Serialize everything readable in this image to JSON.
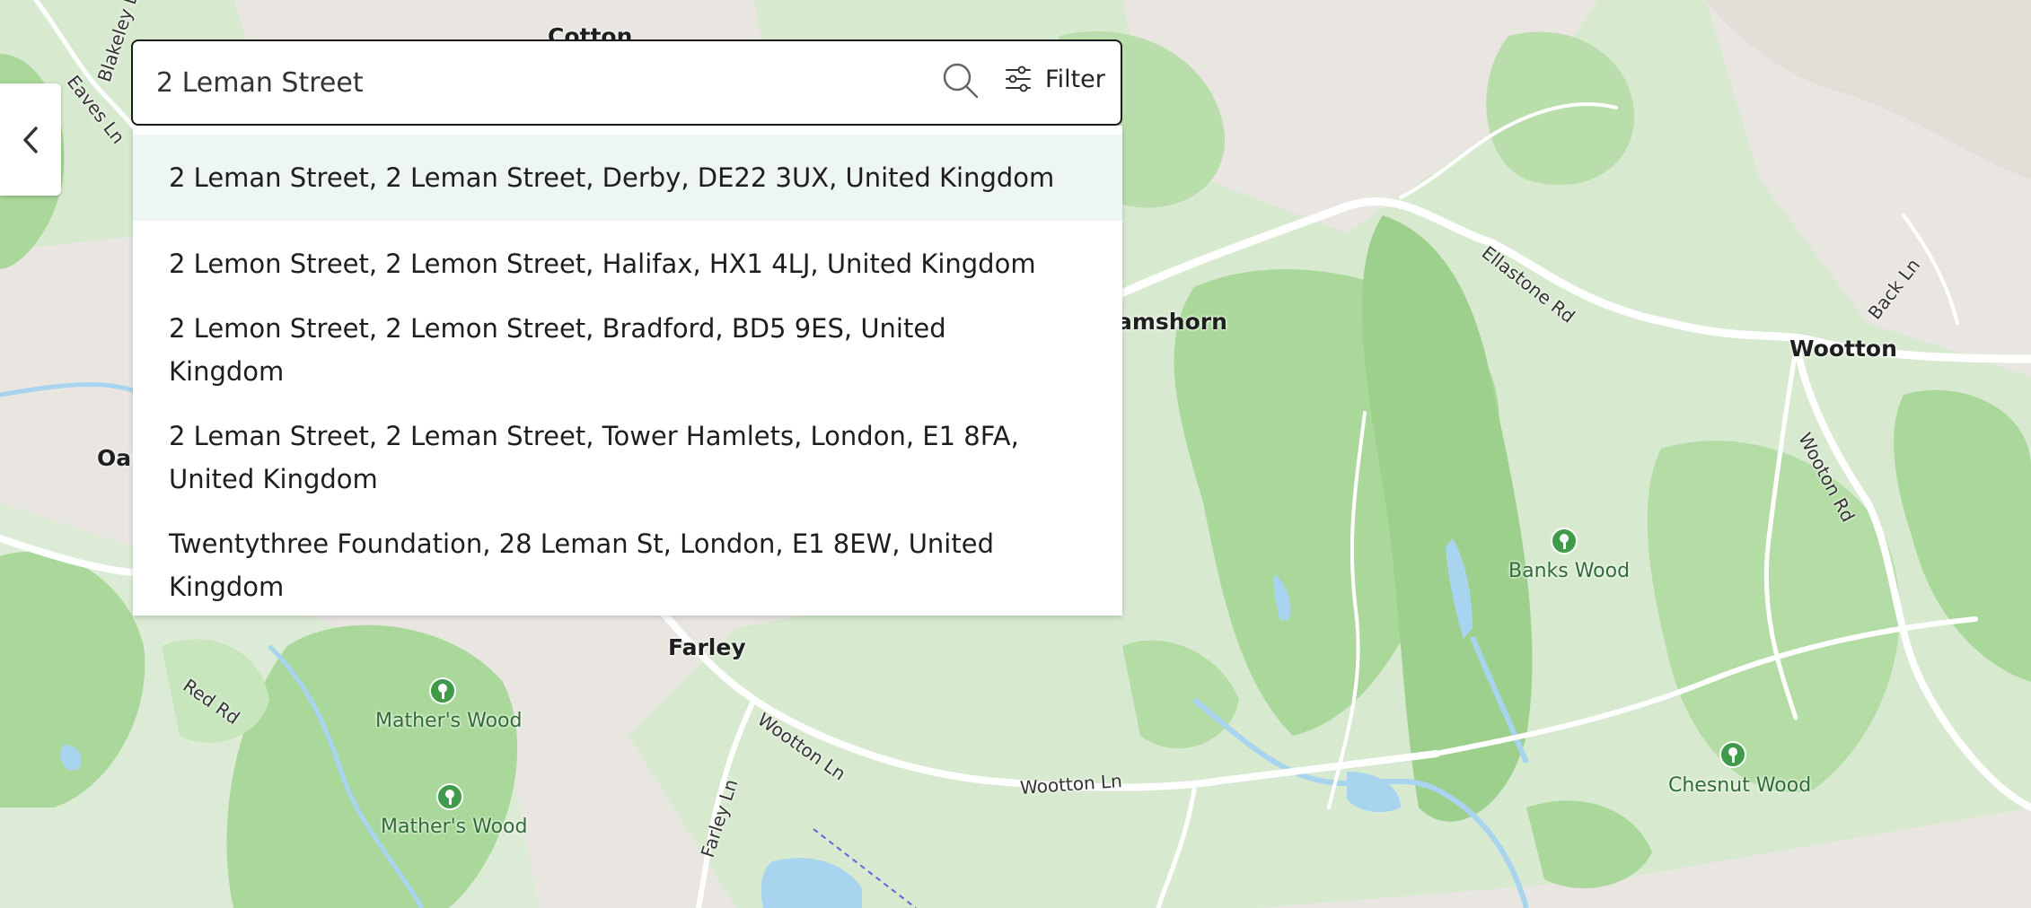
{
  "search": {
    "value": "2 Leman Street",
    "filter_label": "Filter"
  },
  "results": [
    "2 Leman Street, 2 Leman Street, Derby, DE22 3UX, United Kingdom",
    "2 Lemon Street, 2 Lemon Street, Halifax, HX1 4LJ, United Kingdom",
    "2 Lemon Street, 2 Lemon Street, Bradford, BD5 9ES, United Kingdom",
    "2 Leman Street, 2 Leman Street, Tower Hamlets, London, E1 8FA, United Kingdom",
    "Twentythree Foundation, 28 Leman St, London, E1 8EW, United Kingdom"
  ],
  "map": {
    "places": {
      "cotton": "Cotton",
      "oak": "Oak",
      "ramshorn": "amshorn",
      "wootton": "Wootton",
      "farley": "Farley"
    },
    "roads": {
      "blakeley": "Blakeley L",
      "eaves": "Eaves Ln",
      "ellastone": "Ellastone Rd",
      "back": "Back Ln",
      "wooton_rd": "Wooton Rd",
      "red_rd": "Red Rd",
      "wootton_ln_1": "Wootton Ln",
      "wootton_ln_2": "Wootton Ln",
      "farley_ln": "Farley Ln"
    },
    "woods": {
      "banks": "Banks Wood",
      "mathers_1": "Mather's Wood",
      "mathers_2": "Mather's Wood",
      "chesnut": "Chesnut Wood"
    }
  },
  "colors": {
    "land": "#e9e6e1",
    "green_light": "#d7ead0",
    "green": "#a9d89a",
    "water": "#a8d4f0",
    "active_row": "#eef6f1",
    "pin": "#3f9a4a"
  }
}
